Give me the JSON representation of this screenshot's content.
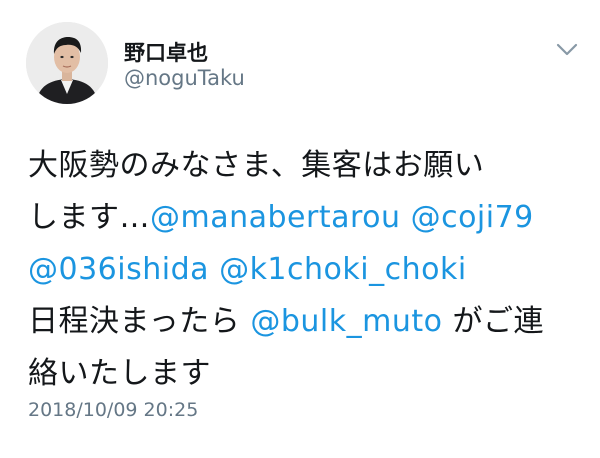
{
  "user": {
    "display_name": "野口卓也",
    "handle": "@noguTaku"
  },
  "tweet": {
    "line1": "大阪勢のみなさま、集客はお願い",
    "line2_prefix": "します…",
    "mention1": "@manabertarou",
    "mention2": "@coji79",
    "mention3": "@036ishida",
    "mention4": "@k1choki_choki",
    "line4_prefix": "日程決まったら",
    "mention5": "@bulk_muto",
    "line4_suffix": "がご連",
    "line5": "絡いたします"
  },
  "timestamp": "2018/10/09 20:25",
  "icons": {
    "menu": "chevron-down-icon",
    "avatar": "profile-photo"
  },
  "colors": {
    "mention": "#1b95e0",
    "secondary_text": "#657786",
    "primary_text": "#14171a"
  }
}
